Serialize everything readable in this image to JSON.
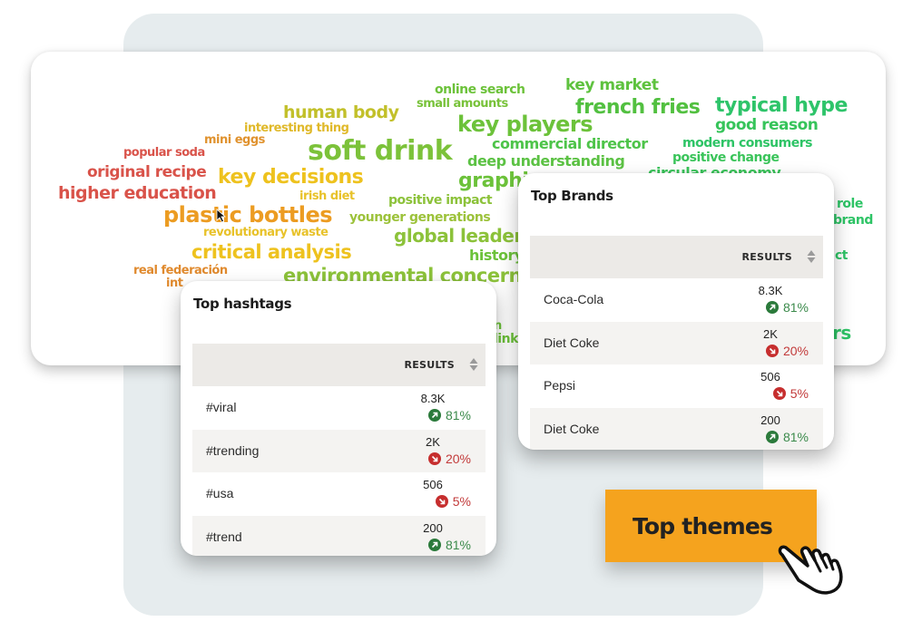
{
  "colors": {
    "background_panel": "#e6ecee",
    "accent_button": "#f5a31e",
    "trend_up": "#2b7a3b",
    "trend_down": "#c62e2e",
    "table_header_bg": "#eceae7"
  },
  "word_cloud": {
    "words": [
      {
        "text": "online search",
        "color": "#6cc23a"
      },
      {
        "text": "small amounts",
        "color": "#78c23a"
      },
      {
        "text": "key market",
        "color": "#5ec23e"
      },
      {
        "text": "french fries",
        "color": "#52c040"
      },
      {
        "text": "typical hype",
        "color": "#2ec46a"
      },
      {
        "text": "good reason",
        "color": "#36c45a"
      },
      {
        "text": "human body",
        "color": "#c2c02a"
      },
      {
        "text": "interesting thing",
        "color": "#e0b92a"
      },
      {
        "text": "key players",
        "color": "#6cc23a"
      },
      {
        "text": "commercial director",
        "color": "#4ec44a"
      },
      {
        "text": "modern consumers",
        "color": "#2ec466"
      },
      {
        "text": "soft drink",
        "color": "#7cc23a"
      },
      {
        "text": "mini eggs",
        "color": "#e0922e"
      },
      {
        "text": "popular soda",
        "color": "#d9534a"
      },
      {
        "text": "deep understanding",
        "color": "#5cc244"
      },
      {
        "text": "positive change",
        "color": "#3ac45a"
      },
      {
        "text": "circular economy",
        "color": "#3ac45a"
      },
      {
        "text": "original recipe",
        "color": "#d9534a"
      },
      {
        "text": "key decisions",
        "color": "#eec21e"
      },
      {
        "text": "higher education",
        "color": "#d9534a"
      },
      {
        "text": "irish diet",
        "color": "#e8c22a"
      },
      {
        "text": "graphic",
        "color": "#6cc23a"
      },
      {
        "text": "positive impact",
        "color": "#8cc23a"
      },
      {
        "text": "plastic bottles",
        "color": "#ec9c22"
      },
      {
        "text": "younger generations",
        "color": "#9cc23a"
      },
      {
        "text": "revolutionary waste",
        "color": "#e8c22a"
      },
      {
        "text": "global leader",
        "color": "#8cc23a"
      },
      {
        "text": "critical analysis",
        "color": "#eec21e"
      },
      {
        "text": "history",
        "color": "#6cc23a"
      },
      {
        "text": "real federación",
        "color": "#e08a2e"
      },
      {
        "text": "environmental concern",
        "color": "#8cc23a"
      },
      {
        "text": "int",
        "color": "#e08a2e"
      },
      {
        "text": "role",
        "color": "#2ec466"
      },
      {
        "text": "brand",
        "color": "#2ec466"
      },
      {
        "text": "ct",
        "color": "#2ec466"
      },
      {
        "text": "rs",
        "color": "#2ec466"
      },
      {
        "text": "n",
        "color": "#6cc23a"
      },
      {
        "text": "link",
        "color": "#6cc23a"
      }
    ]
  },
  "hashtags_card": {
    "title": "Top hashtags",
    "column_header": "RESULTS",
    "rows": [
      {
        "label": "#viral",
        "value": "8.3K",
        "change": "81%",
        "direction": "up"
      },
      {
        "label": "#trending",
        "value": "2K",
        "change": "20%",
        "direction": "down"
      },
      {
        "label": "#usa",
        "value": "506",
        "change": "5%",
        "direction": "down"
      },
      {
        "label": "#trend",
        "value": "200",
        "change": "81%",
        "direction": "up"
      }
    ]
  },
  "brands_card": {
    "title": "Top Brands",
    "column_header": "RESULTS",
    "rows": [
      {
        "label": "Coca-Cola",
        "value": "8.3K",
        "change": "81%",
        "direction": "up"
      },
      {
        "label": "Diet Coke",
        "value": "2K",
        "change": "20%",
        "direction": "down"
      },
      {
        "label": "Pepsi",
        "value": "506",
        "change": "5%",
        "direction": "down"
      },
      {
        "label": "Diet Coke",
        "value": "200",
        "change": "81%",
        "direction": "up"
      }
    ]
  },
  "cta": {
    "label": "Top themes",
    "icon": "pointing-hand-icon"
  }
}
